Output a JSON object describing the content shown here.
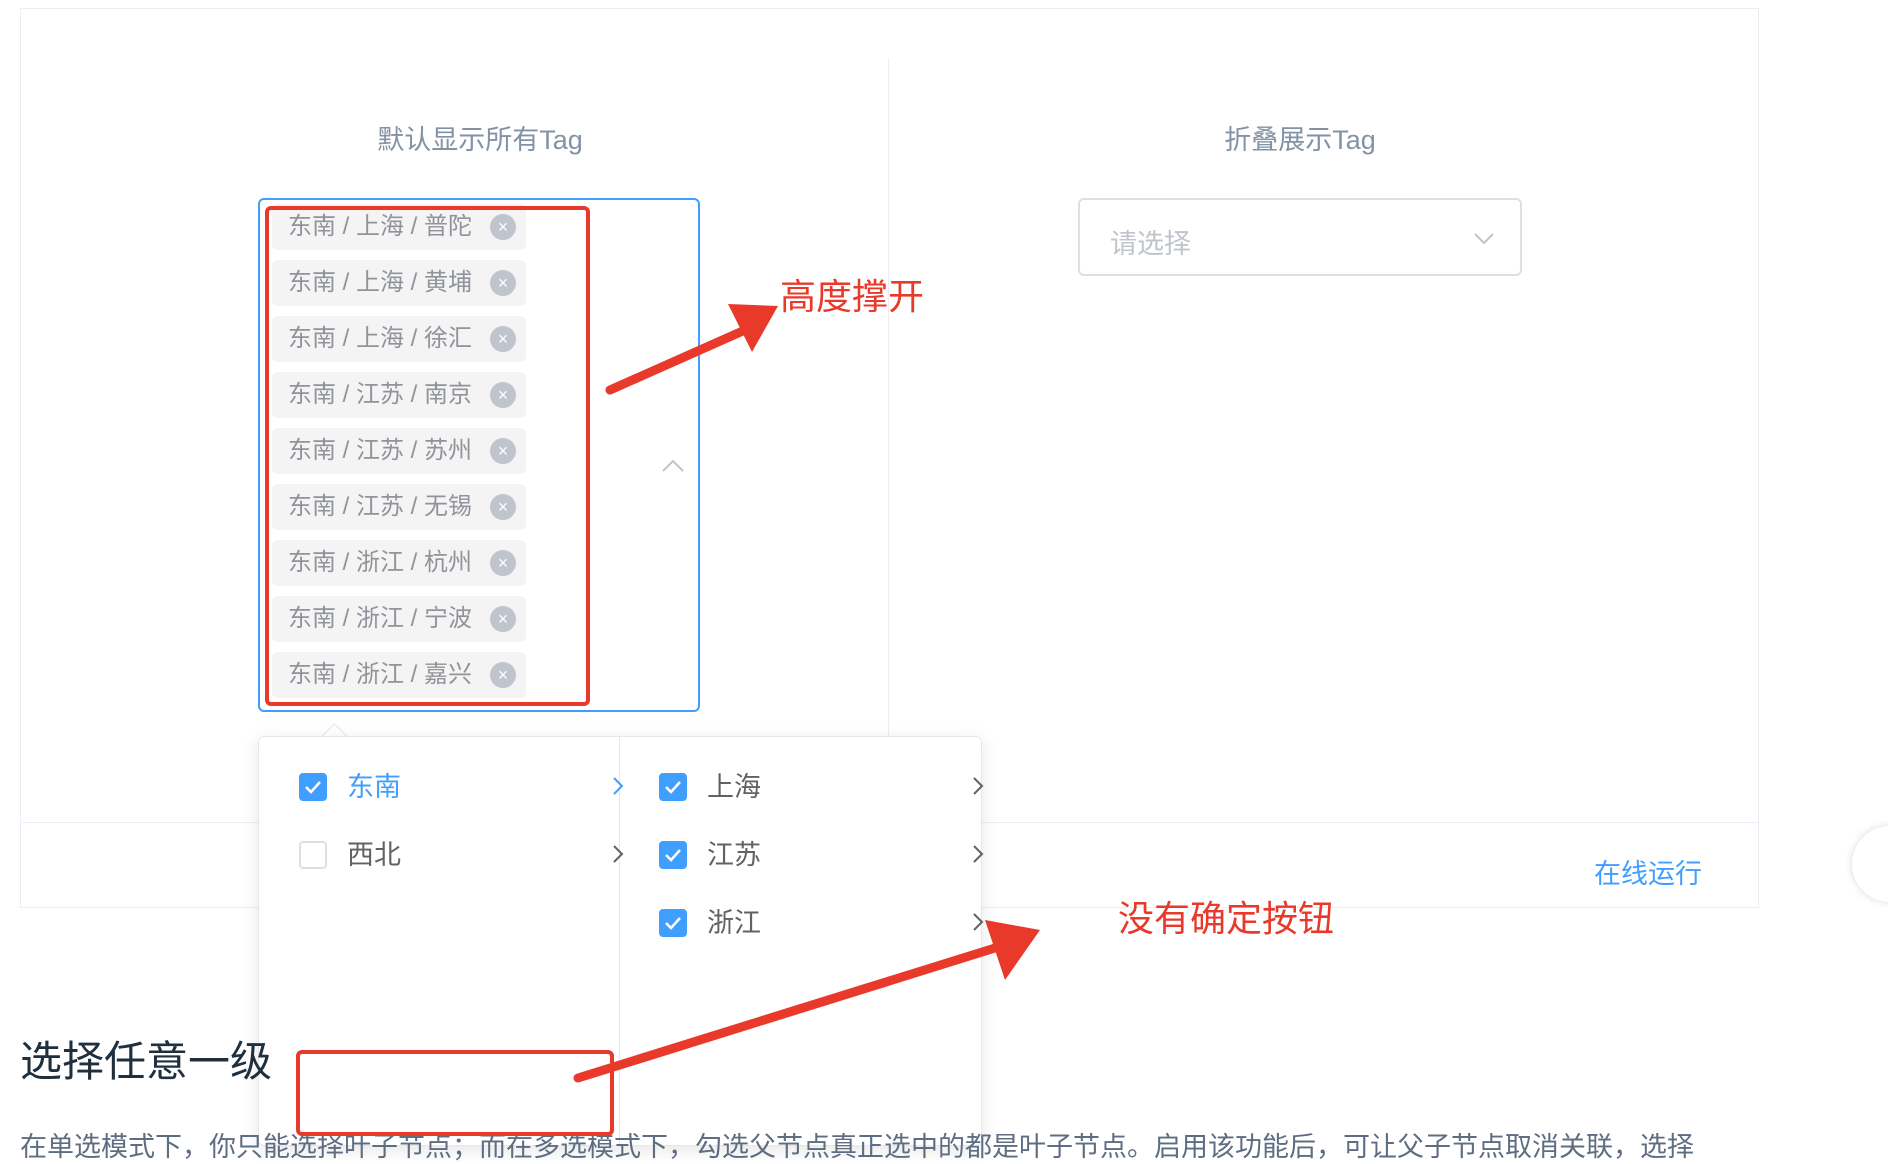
{
  "demo": {
    "left_title": "默认显示所有Tag",
    "right_title": "折叠展示Tag",
    "right_placeholder": "请选择",
    "run_online": "在线运行"
  },
  "tags": [
    {
      "label": "东南 / 上海 / 普陀"
    },
    {
      "label": "东南 / 上海 / 黄埔"
    },
    {
      "label": "东南 / 上海 / 徐汇"
    },
    {
      "label": "东南 / 江苏 / 南京"
    },
    {
      "label": "东南 / 江苏 / 苏州"
    },
    {
      "label": "东南 / 江苏 / 无锡"
    },
    {
      "label": "东南 / 浙江 / 杭州"
    },
    {
      "label": "东南 / 浙江 / 宁波"
    },
    {
      "label": "东南 / 浙江 / 嘉兴"
    }
  ],
  "menu_level1": [
    {
      "label": "东南",
      "checked": true,
      "active": true
    },
    {
      "label": "西北",
      "checked": false,
      "active": false
    }
  ],
  "menu_level2": [
    {
      "label": "上海",
      "checked": true
    },
    {
      "label": "江苏",
      "checked": true
    },
    {
      "label": "浙江",
      "checked": true
    }
  ],
  "section": {
    "heading": "选择任意一级",
    "paragraph": "在单选模式下，你只能选择叶子节点；而在多选模式下，勾选父节点真正选中的都是叶子节点。启用该功能后，可让父子节点取消关联，选择"
  },
  "annotations": {
    "height_note": "高度撑开",
    "no_confirm_note": "没有确定按钮"
  },
  "colors": {
    "primary": "#409eff",
    "annotation": "#e8392a",
    "tag_bg": "#f4f4f5"
  }
}
